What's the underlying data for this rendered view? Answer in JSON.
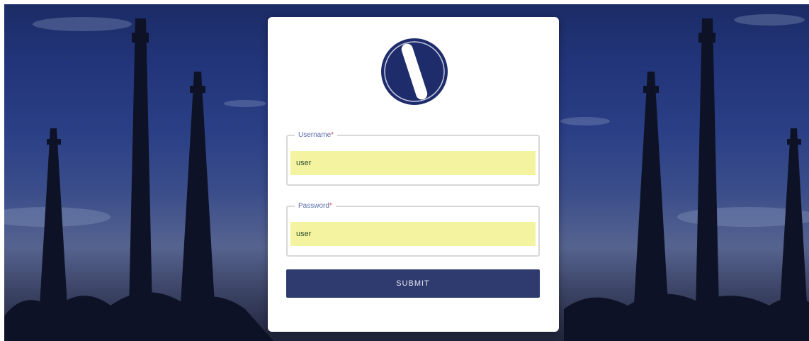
{
  "login": {
    "username_label": "Username",
    "username_required_mark": "*",
    "username_value": "user",
    "password_label": "Password",
    "password_required_mark": "*",
    "password_value": "user",
    "submit_label": "SUBMIT"
  },
  "icons": {
    "brand": "brand-logo-icon"
  },
  "colors": {
    "sky_top": "#1b2c66",
    "sky_bottom": "#20243a",
    "logo": "#1f2c6b",
    "input_autofill": "#f4f4a0",
    "submit_button": "#2f3b6e"
  }
}
